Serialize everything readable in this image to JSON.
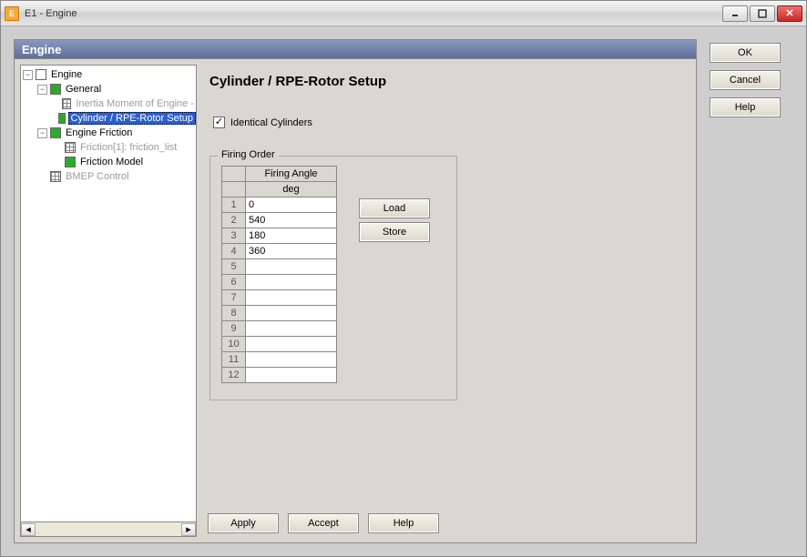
{
  "window": {
    "title": "E1 - Engine"
  },
  "panel": {
    "title": "Engine"
  },
  "tree": {
    "root": "Engine",
    "general": "General",
    "inertia": "Inertia Moment of Engine -",
    "cylinder": "Cylinder / RPE-Rotor Setup",
    "friction": "Engine Friction",
    "friction1": "Friction[1]: friction_list",
    "friction_model": "Friction Model",
    "bmep": "BMEP Control"
  },
  "content": {
    "heading": "Cylinder / RPE-Rotor Setup",
    "identical_label": "Identical Cylinders",
    "identical_checked": "✓",
    "firing_order_legend": "Firing Order",
    "col_header": "Firing Angle",
    "col_unit": "deg",
    "rows": {
      "r1": "1",
      "r2": "2",
      "r3": "3",
      "r4": "4",
      "r5": "5",
      "r6": "6",
      "r7": "7",
      "r8": "8",
      "r9": "9",
      "r10": "10",
      "r11": "11",
      "r12": "12"
    },
    "vals": {
      "v1": "0",
      "v2": "540",
      "v3": "180",
      "v4": "360",
      "v5": "",
      "v6": "",
      "v7": "",
      "v8": "",
      "v9": "",
      "v10": "",
      "v11": "",
      "v12": ""
    },
    "load_btn": "Load",
    "store_btn": "Store",
    "apply_btn": "Apply",
    "accept_btn": "Accept",
    "help_btn": "Help"
  },
  "right": {
    "ok": "OK",
    "cancel": "Cancel",
    "help": "Help"
  }
}
